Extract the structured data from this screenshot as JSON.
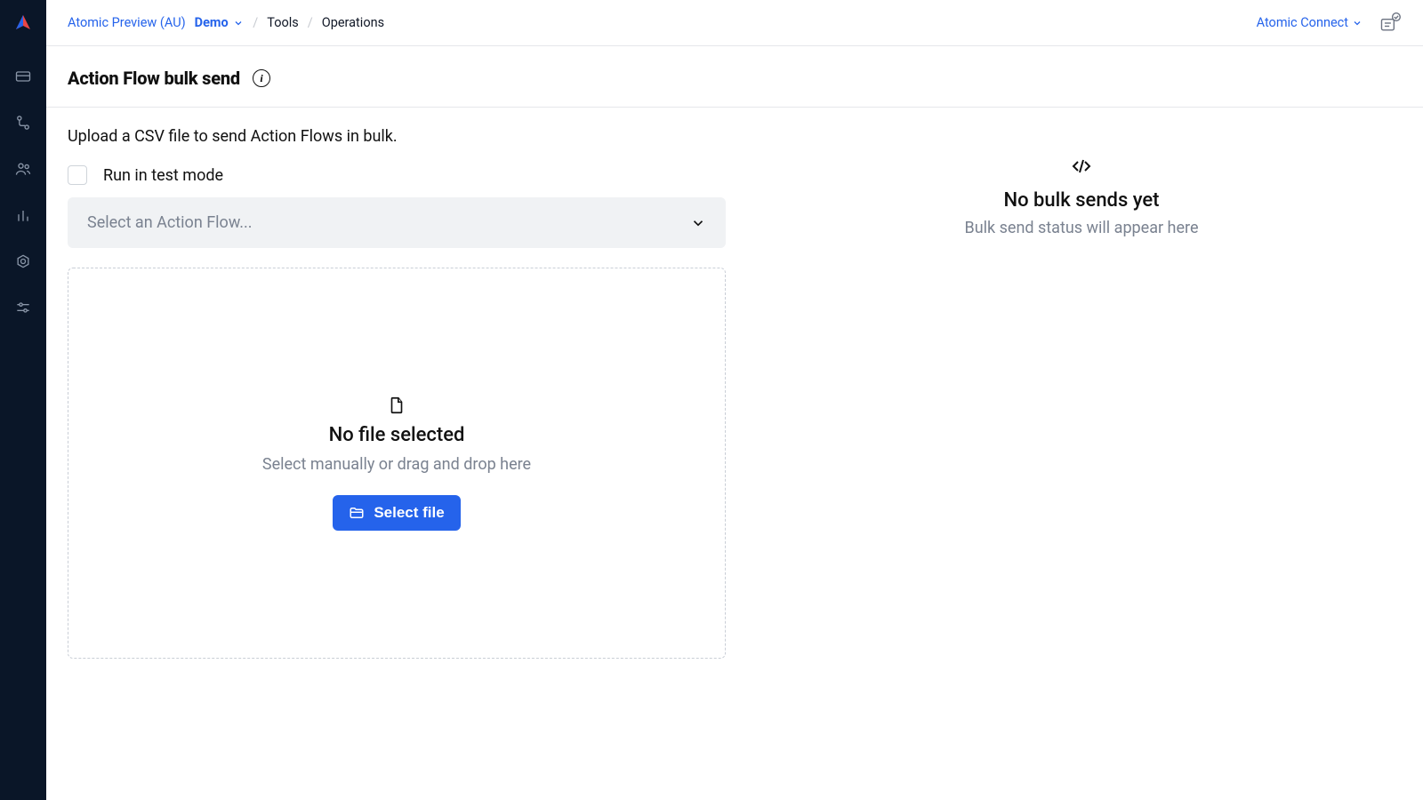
{
  "breadcrumb": {
    "org": "Atomic Preview (AU)",
    "env": "Demo",
    "section": "Tools",
    "page": "Operations"
  },
  "topbar": {
    "connect_label": "Atomic Connect"
  },
  "page": {
    "title": "Action Flow bulk send",
    "intro": "Upload a CSV file to send Action Flows in bulk."
  },
  "form": {
    "test_mode_label": "Run in test mode",
    "select_placeholder": "Select an Action Flow..."
  },
  "dropzone": {
    "title": "No file selected",
    "sub": "Select manually or drag and drop here",
    "button": "Select file"
  },
  "status_panel": {
    "title": "No bulk sends yet",
    "sub": "Bulk send status will appear here"
  }
}
